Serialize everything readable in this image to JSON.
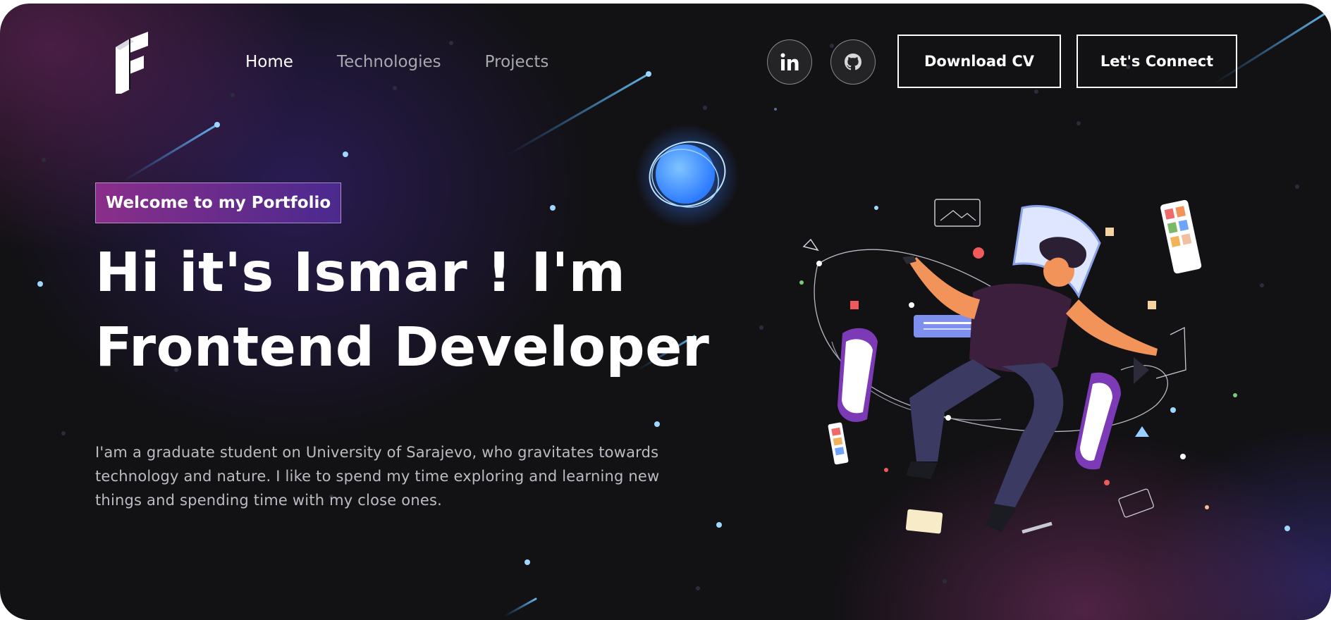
{
  "nav": {
    "logo_icon": "logo-f-icon",
    "links": [
      {
        "label": "Home",
        "active": true
      },
      {
        "label": "Technologies",
        "active": false
      },
      {
        "label": "Projects",
        "active": false
      }
    ]
  },
  "social": {
    "linkedin_icon": "linkedin-icon",
    "github_icon": "github-icon"
  },
  "buttons": {
    "download_cv": "Download CV",
    "connect": "Let's Connect"
  },
  "hero": {
    "tagline": "Welcome to my Portfolio",
    "headline_line1": "Hi it's Ismar ! I'm",
    "headline_line2": "Frontend Developer",
    "bio": "I'am a graduate student on University of Sarajevo, who gravitates towards technology and nature. I like to spend my time exploring and learning new things and spending time with my close ones."
  },
  "colors": {
    "background": "#121114",
    "tagline_gradient_start": "#8a2e8a",
    "tagline_gradient_end": "#4a2a8e",
    "text_primary": "#ffffff",
    "text_muted": "#a9a8ad"
  }
}
